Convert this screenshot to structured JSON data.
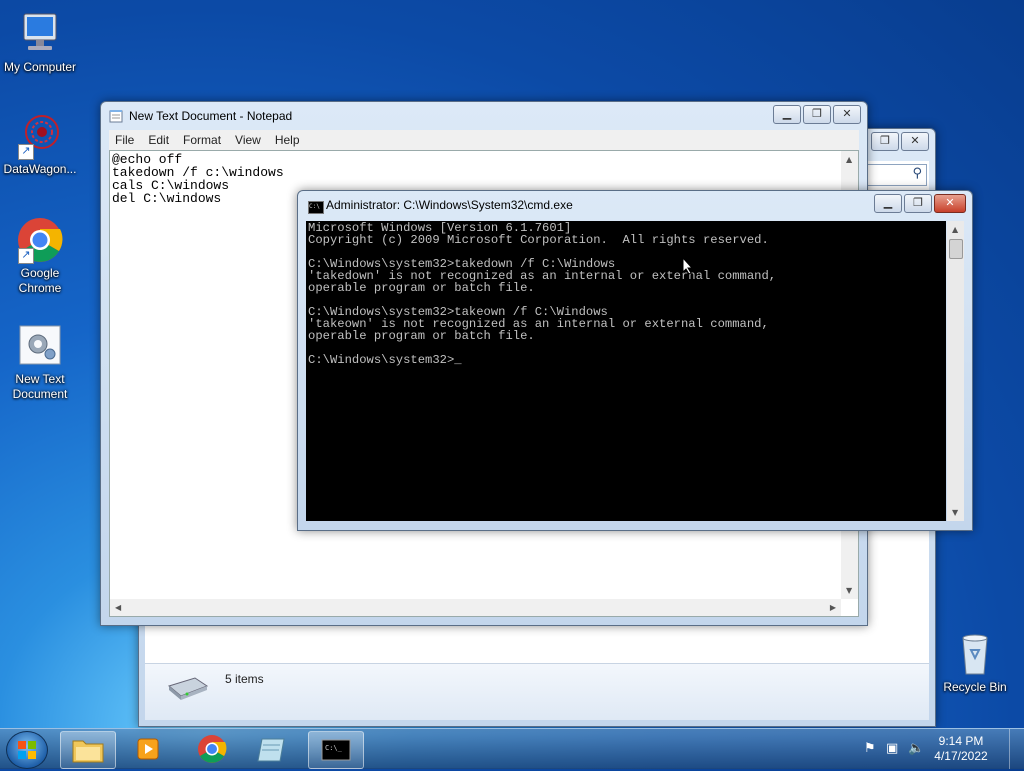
{
  "desktop": {
    "icons": [
      {
        "label": "My Computer"
      },
      {
        "label": "DataWagon..."
      },
      {
        "label": "Google Chrome"
      },
      {
        "label": "New Text Document"
      },
      {
        "label": "Recycle Bin"
      }
    ]
  },
  "explorer": {
    "status": "5 items"
  },
  "notepad": {
    "title": "New Text Document - Notepad",
    "menu": [
      "File",
      "Edit",
      "Format",
      "View",
      "Help"
    ],
    "content": "@echo off\ntakedown /f c:\\windows\ncals C:\\windows\ndel C:\\windows"
  },
  "cmd": {
    "title": "Administrator: C:\\Windows\\System32\\cmd.exe",
    "output": "Microsoft Windows [Version 6.1.7601]\nCopyright (c) 2009 Microsoft Corporation.  All rights reserved.\n\nC:\\Windows\\system32>takedown /f C:\\Windows\n'takedown' is not recognized as an internal or external command,\noperable program or batch file.\n\nC:\\Windows\\system32>takeown /f C:\\Windows\n'takeown' is not recognized as an internal or external command,\noperable program or batch file.\n\nC:\\Windows\\system32>_"
  },
  "taskbar": {
    "time": "9:14 PM",
    "date": "4/17/2022"
  },
  "colors": {
    "desktop": "#1565c8",
    "cmd_bg": "#000000",
    "cmd_fg": "#c0c0c0",
    "close_button": "#c7402a"
  }
}
